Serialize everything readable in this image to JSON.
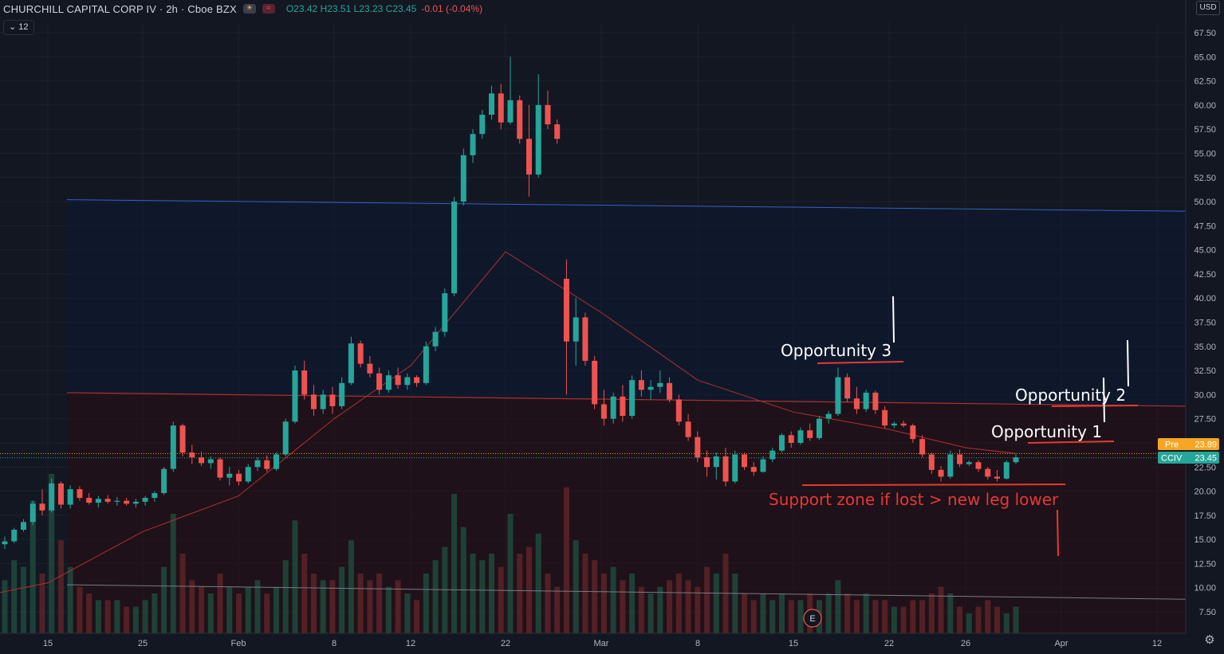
{
  "header": {
    "symbol": "CHURCHILL CAPITAL CORP IV · 2h · Cboe BZX",
    "ohlc_open": "O23.42",
    "ohlc_high": "H23.51",
    "ohlc_low": "L23.23",
    "ohlc_close": "C23.45",
    "change": "-0.01 (-0.04%)",
    "sun_icon": "sun-icon",
    "events_icon": "events-icon"
  },
  "volume_badge": {
    "label": "12",
    "icon": "chevron-down-icon"
  },
  "currency": "USD",
  "colors": {
    "background": "#131722",
    "up": "#26a69a",
    "down": "#ef5350",
    "resistance_line": "#3461c7",
    "mid_line": "#b0302e",
    "support_line": "#787b86",
    "annotation_red": "#e53935",
    "price_label": "#26a69a",
    "pre_label": "#f5a623"
  },
  "chart_data": {
    "type": "candlestick",
    "y_axis": {
      "ticks": [
        "67.50",
        "65.00",
        "62.50",
        "60.00",
        "57.50",
        "55.00",
        "52.50",
        "50.00",
        "47.50",
        "45.00",
        "42.50",
        "40.00",
        "37.50",
        "35.00",
        "32.50",
        "30.00",
        "27.50",
        "25.00",
        "22.50",
        "20.00",
        "17.50",
        "15.00",
        "12.50",
        "10.00",
        "7.50"
      ],
      "ylim": [
        5.5,
        69
      ]
    },
    "x_axis": {
      "ticks": [
        "15",
        "25",
        "Feb",
        "8",
        "12",
        "22",
        "Mar",
        "8",
        "15",
        "22",
        "26",
        "Apr",
        "12"
      ]
    },
    "price_labels": [
      {
        "name": "Pre",
        "value": "23.89"
      },
      {
        "name": "CCIV",
        "value": "23.45"
      }
    ],
    "candles": [
      [
        14.5,
        15.3,
        14.0,
        14.8
      ],
      [
        14.8,
        16.2,
        14.6,
        16.0
      ],
      [
        16.0,
        17.1,
        15.8,
        16.8
      ],
      [
        16.8,
        19.0,
        16.5,
        18.7
      ],
      [
        18.7,
        20.2,
        17.5,
        18.0
      ],
      [
        18.0,
        21.3,
        17.8,
        20.8
      ],
      [
        20.8,
        21.0,
        18.2,
        18.6
      ],
      [
        18.6,
        20.6,
        18.2,
        20.2
      ],
      [
        20.2,
        20.5,
        19.0,
        19.3
      ],
      [
        19.3,
        19.8,
        18.6,
        18.8
      ],
      [
        18.8,
        19.5,
        18.3,
        19.2
      ],
      [
        19.2,
        19.6,
        18.7,
        18.9
      ],
      [
        18.9,
        19.4,
        18.5,
        19.0
      ],
      [
        19.0,
        19.3,
        18.5,
        18.7
      ],
      [
        18.7,
        19.2,
        18.3,
        18.9
      ],
      [
        18.9,
        19.5,
        18.5,
        19.3
      ],
      [
        19.3,
        20.0,
        18.9,
        19.8
      ],
      [
        19.8,
        22.5,
        19.6,
        22.3
      ],
      [
        22.3,
        27.2,
        22.0,
        26.8
      ],
      [
        26.8,
        27.0,
        23.6,
        24.0
      ],
      [
        24.0,
        24.8,
        22.8,
        23.5
      ],
      [
        23.5,
        24.1,
        22.6,
        22.9
      ],
      [
        22.9,
        23.6,
        22.3,
        23.3
      ],
      [
        23.3,
        23.5,
        21.1,
        21.4
      ],
      [
        21.4,
        22.5,
        20.6,
        21.8
      ],
      [
        21.8,
        22.2,
        20.6,
        21.0
      ],
      [
        21.0,
        22.8,
        20.8,
        22.5
      ],
      [
        22.5,
        23.5,
        22.1,
        23.2
      ],
      [
        23.2,
        23.7,
        22.0,
        22.3
      ],
      [
        22.3,
        24.0,
        22.1,
        23.8
      ],
      [
        23.8,
        27.5,
        23.6,
        27.2
      ],
      [
        27.2,
        33.0,
        27.0,
        32.5
      ],
      [
        32.5,
        33.5,
        29.5,
        30.0
      ],
      [
        30.0,
        31.0,
        27.8,
        28.5
      ],
      [
        28.5,
        30.5,
        28.0,
        30.0
      ],
      [
        30.0,
        30.8,
        28.0,
        28.8
      ],
      [
        28.8,
        31.8,
        28.5,
        31.2
      ],
      [
        31.2,
        36.0,
        31.0,
        35.3
      ],
      [
        35.3,
        35.6,
        32.8,
        33.2
      ],
      [
        33.2,
        34.0,
        31.8,
        32.2
      ],
      [
        32.2,
        32.8,
        30.0,
        30.5
      ],
      [
        30.5,
        32.5,
        30.2,
        32.0
      ],
      [
        32.0,
        32.8,
        30.6,
        31.0
      ],
      [
        31.0,
        32.2,
        30.5,
        31.8
      ],
      [
        31.8,
        32.0,
        30.8,
        31.2
      ],
      [
        31.2,
        35.5,
        31.0,
        35.0
      ],
      [
        35.0,
        37.0,
        34.5,
        36.5
      ],
      [
        36.5,
        41.0,
        36.0,
        40.5
      ],
      [
        40.5,
        50.5,
        40.2,
        50.0
      ],
      [
        50.0,
        55.5,
        49.6,
        54.8
      ],
      [
        54.8,
        57.5,
        54.0,
        57.0
      ],
      [
        57.0,
        59.5,
        56.5,
        59.0
      ],
      [
        59.0,
        62.0,
        58.5,
        61.2
      ],
      [
        61.2,
        62.2,
        57.5,
        58.2
      ],
      [
        58.2,
        65.0,
        58.0,
        60.5
      ],
      [
        60.5,
        61.0,
        56.0,
        56.5
      ],
      [
        56.5,
        60.0,
        50.5,
        52.8
      ],
      [
        52.8,
        63.2,
        52.5,
        60.0
      ],
      [
        60.0,
        61.5,
        57.5,
        58.0
      ],
      [
        58.0,
        58.5,
        56.0,
        56.5
      ],
      [
        42.0,
        44.0,
        30.0,
        35.5
      ],
      [
        35.5,
        40.0,
        33.0,
        38.0
      ],
      [
        38.0,
        38.5,
        33.0,
        33.5
      ],
      [
        33.5,
        34.0,
        28.5,
        29.0
      ],
      [
        29.0,
        30.5,
        26.8,
        27.5
      ],
      [
        27.5,
        30.2,
        27.0,
        29.8
      ],
      [
        29.8,
        31.0,
        27.2,
        27.8
      ],
      [
        27.8,
        32.0,
        27.5,
        31.5
      ],
      [
        31.5,
        32.5,
        29.8,
        30.5
      ],
      [
        30.5,
        31.5,
        29.5,
        30.8
      ],
      [
        30.8,
        32.5,
        30.2,
        31.2
      ],
      [
        31.2,
        31.8,
        29.2,
        29.5
      ],
      [
        29.5,
        30.0,
        26.8,
        27.2
      ],
      [
        27.2,
        28.0,
        25.2,
        25.6
      ],
      [
        25.6,
        26.2,
        23.0,
        23.5
      ],
      [
        23.5,
        24.2,
        21.5,
        22.5
      ],
      [
        22.5,
        24.0,
        21.2,
        23.6
      ],
      [
        23.6,
        24.5,
        20.5,
        21.0
      ],
      [
        21.0,
        24.2,
        20.8,
        23.8
      ],
      [
        23.8,
        24.0,
        22.2,
        22.5
      ],
      [
        22.5,
        23.0,
        21.6,
        22.0
      ],
      [
        22.0,
        23.6,
        21.9,
        23.3
      ],
      [
        23.3,
        24.5,
        23.0,
        24.2
      ],
      [
        24.2,
        26.0,
        24.0,
        25.8
      ],
      [
        25.8,
        26.2,
        24.5,
        25.0
      ],
      [
        25.0,
        26.6,
        24.8,
        26.3
      ],
      [
        26.3,
        27.0,
        25.2,
        25.5
      ],
      [
        25.5,
        27.8,
        25.3,
        27.5
      ],
      [
        27.5,
        28.3,
        27.0,
        28.0
      ],
      [
        28.0,
        32.8,
        27.8,
        31.8
      ],
      [
        31.8,
        32.2,
        29.2,
        29.6
      ],
      [
        29.6,
        30.8,
        28.0,
        28.5
      ],
      [
        28.5,
        30.5,
        28.2,
        30.2
      ],
      [
        30.2,
        30.4,
        28.0,
        28.4
      ],
      [
        28.4,
        28.8,
        26.5,
        26.8
      ],
      [
        26.8,
        27.2,
        26.5,
        27.0
      ],
      [
        27.0,
        27.3,
        26.6,
        26.8
      ],
      [
        26.8,
        27.0,
        25.0,
        25.4
      ],
      [
        25.4,
        25.8,
        23.5,
        23.8
      ],
      [
        23.8,
        24.0,
        21.8,
        22.2
      ],
      [
        22.2,
        22.6,
        21.0,
        21.5
      ],
      [
        21.5,
        24.2,
        21.3,
        23.8
      ],
      [
        23.8,
        24.3,
        22.5,
        22.8
      ],
      [
        22.8,
        23.2,
        22.6,
        23.0
      ],
      [
        23.0,
        23.2,
        22.0,
        22.3
      ],
      [
        22.3,
        22.5,
        21.2,
        21.5
      ],
      [
        21.5,
        22.2,
        21.0,
        21.3
      ],
      [
        21.3,
        23.2,
        21.2,
        23.0
      ],
      [
        23.0,
        23.8,
        22.8,
        23.5
      ]
    ],
    "volumes": [
      8,
      11,
      10,
      20,
      9,
      24,
      14,
      10,
      7,
      6,
      5,
      5,
      5,
      4,
      4,
      5,
      6,
      10,
      18,
      12,
      8,
      7,
      6,
      9,
      7,
      6,
      7,
      8,
      6,
      7,
      11,
      17,
      12,
      9,
      8,
      8,
      10,
      14,
      9,
      8,
      9,
      7,
      8,
      6,
      5,
      9,
      11,
      13,
      21,
      16,
      12,
      11,
      12,
      10,
      18,
      12,
      13,
      15,
      9,
      7,
      22,
      14,
      12,
      11,
      9,
      10,
      8,
      9,
      7,
      6,
      7,
      8,
      9,
      8,
      7,
      10,
      9,
      12,
      9,
      6,
      5,
      6,
      5,
      6,
      5,
      5,
      6,
      5,
      6,
      8,
      6,
      5,
      6,
      5,
      5,
      4,
      4,
      5,
      5,
      6,
      7,
      6,
      4,
      3,
      4,
      5,
      4,
      3,
      4
    ],
    "moving_average": [
      [
        "15",
        10.5
      ],
      [
        "25",
        15.8
      ],
      [
        "Feb",
        19.5
      ],
      [
        "8",
        27.5
      ],
      [
        "12",
        33.0
      ],
      [
        "22",
        44.8
      ],
      [
        "Mar",
        38.5
      ],
      [
        "8",
        31.5
      ],
      [
        "15",
        28.2
      ],
      [
        "22",
        26.4
      ],
      [
        "26",
        24.5
      ]
    ]
  },
  "overlays": {
    "resistance_line": {
      "from": 50.2,
      "to": 49.0
    },
    "mid_line": {
      "from": 30.2,
      "to": 28.8
    },
    "support_line": {
      "from": 10.3,
      "to": 8.8
    }
  },
  "annotations": [
    {
      "text": "Opportunity 3",
      "color": "#ffffff"
    },
    {
      "text": "Opportunity 2",
      "color": "#ffffff"
    },
    {
      "text": "Opportunity 1",
      "color": "#ffffff"
    },
    {
      "text": "Support zone if lost > new leg lower",
      "color": "#e53935"
    }
  ],
  "earnings_marker": "E",
  "settings_icon": "gear-icon"
}
